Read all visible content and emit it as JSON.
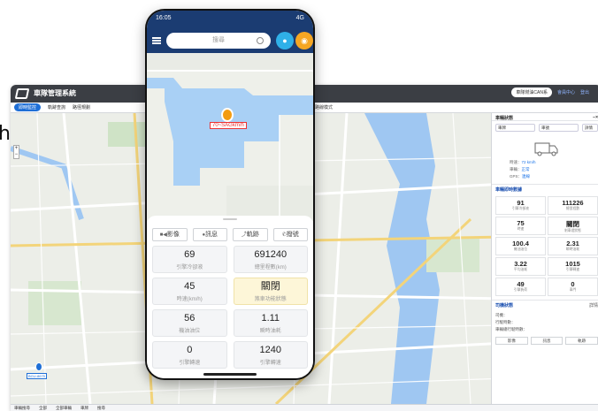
{
  "desktop": {
    "app_title": "車隊管理系統",
    "top_button": "車隊燃油CAN系",
    "top_link_1": "會員中心",
    "top_link_2": "登出",
    "tabs": [
      "即時監控",
      "軌跡查詢",
      "路徑規劃"
    ],
    "map_toolbar": "路線模式",
    "zoom": [
      "+",
      "−"
    ],
    "vehicle_label": "BGU-8675",
    "bottom_bar": [
      "車輛搜尋",
      "全部",
      "全部車輛",
      "車牌",
      "搜尋"
    ]
  },
  "panel": {
    "title": "車輛狀態",
    "selects": [
      "車牌",
      "車號",
      "詳情"
    ],
    "info": [
      {
        "label": "時速",
        "value": "72 km/h"
      },
      {
        "label": "車輛",
        "value": "正常"
      },
      {
        "label": "GPS",
        "value": "連線"
      }
    ],
    "section": "車輛即時數據",
    "stats": [
      {
        "value": "91",
        "label": "引擎冷卻液"
      },
      {
        "value": "111226",
        "label": "總里程數"
      },
      {
        "value": "75",
        "label": "時速"
      },
      {
        "value": "關閉",
        "label": "剎車燈狀態"
      },
      {
        "value": "100.4",
        "label": "機油油位"
      },
      {
        "value": "2.31",
        "label": "瞬時油耗"
      },
      {
        "value": "3.22",
        "label": "平均油耗"
      },
      {
        "value": "1015",
        "label": "引擎轉速"
      },
      {
        "value": "49",
        "label": "引擎負荷"
      },
      {
        "value": "0",
        "label": "車門"
      }
    ],
    "driver_section": "司機狀態",
    "driver_select": "詳情",
    "driver_lines": [
      "司機：",
      "行駛時數：",
      "車輛總行駛時數："
    ],
    "driver_buttons": [
      "影像",
      "訊息",
      "軌跡"
    ]
  },
  "phone": {
    "time": "16:05",
    "signal": "4G",
    "search_placeholder": "搜尋",
    "speed_tag": "70~SAGkm/h",
    "actions": [
      {
        "icon": "■◀",
        "label": "影像"
      },
      {
        "icon": "●",
        "label": "訊息"
      },
      {
        "icon": "⤴",
        "label": "軌跡"
      },
      {
        "icon": "✆",
        "label": "撥號"
      }
    ],
    "cards": [
      {
        "value": "69",
        "label": "引擎冷卻液"
      },
      {
        "value": "691240",
        "label": "總里程數(km)"
      },
      {
        "value": "45",
        "label": "時速(km/h)"
      },
      {
        "value": "關閉",
        "label": "煞車功能狀態"
      },
      {
        "value": "56",
        "label": "機油油位"
      },
      {
        "value": "1.11",
        "label": "瞬時油耗"
      },
      {
        "value": "0",
        "label": "引擎轉速"
      },
      {
        "value": "1240",
        "label": "引擎轉速"
      }
    ]
  },
  "colors": {
    "nav": "#1b3c72",
    "chat": "#2fb0e8",
    "bell": "#f5a623",
    "water": "#a9d0f5",
    "highlight": "#fdf6d8"
  }
}
